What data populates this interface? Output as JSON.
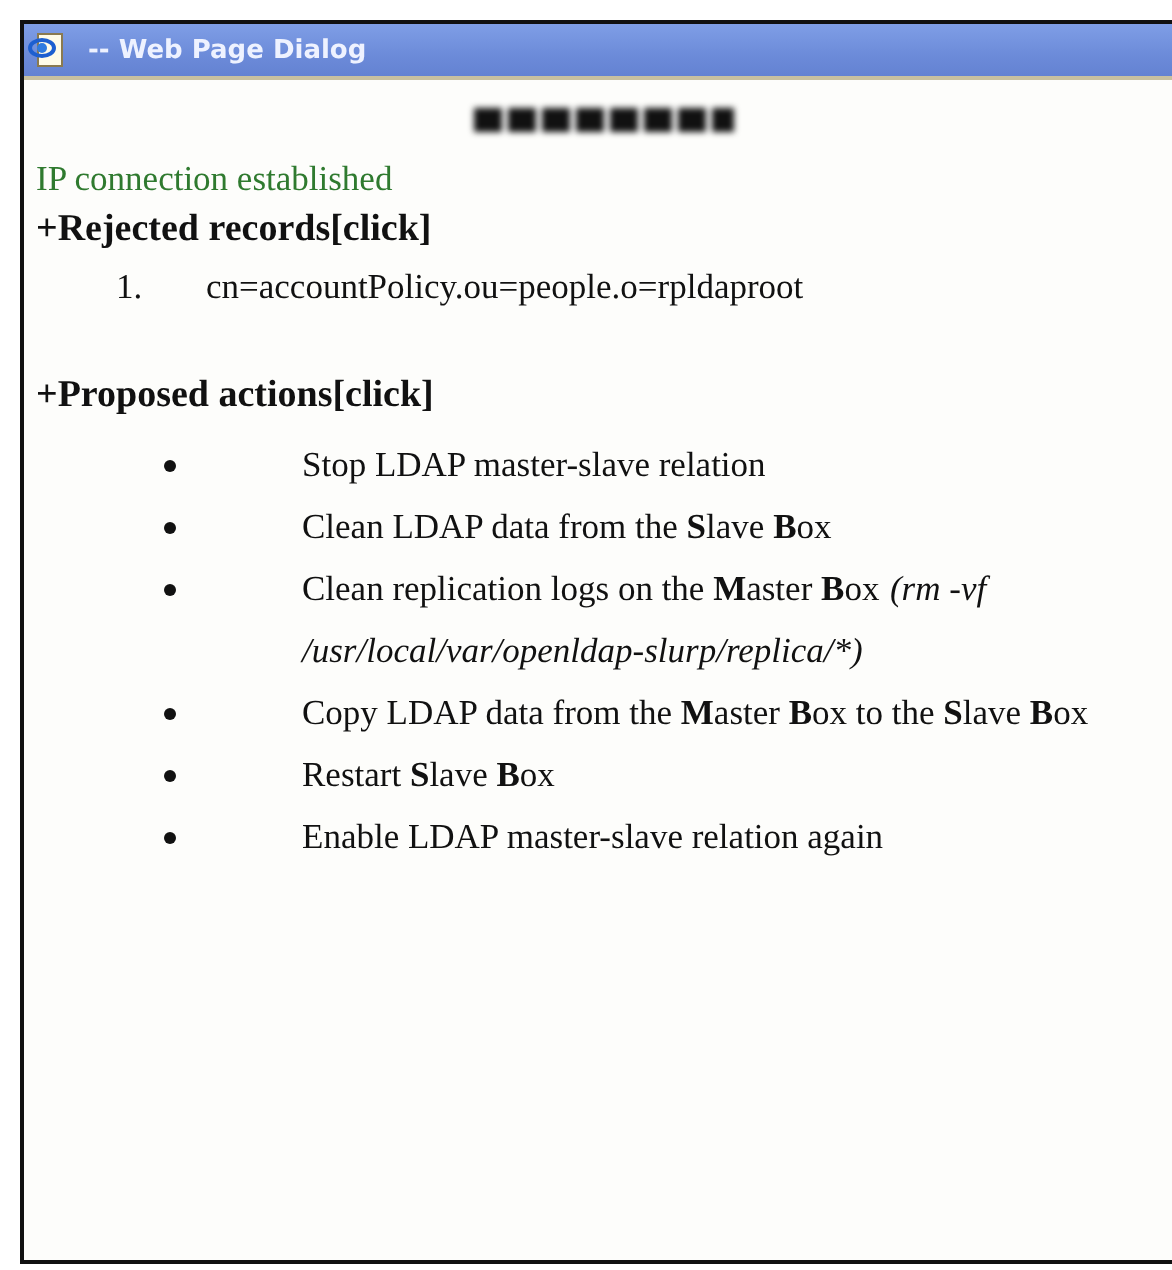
{
  "window": {
    "title": "-- Web Page Dialog"
  },
  "status": "IP connection established",
  "rejected": {
    "heading": "+Rejected records[click]",
    "items": [
      {
        "number": "1.",
        "text": "cn=accountPolicy.ou=people.o=rpldaproot"
      }
    ]
  },
  "proposed": {
    "heading": "+Proposed actions[click]",
    "items": [
      {
        "text": "Stop LDAP master-slave relation"
      },
      {
        "text": "Clean LDAP data from the **S**lave **B**ox"
      },
      {
        "text": "Clean replication logs on the **M**aster **B**ox",
        "note": "(rm -vf /usr/local/var/openldap-slurp/replica/*)"
      },
      {
        "text": "Copy LDAP data from the **M**aster **B**ox to the **S**lave **B**ox"
      },
      {
        "text": "Restart **S**lave **B**ox"
      },
      {
        "text": "Enable LDAP master-slave relation again"
      }
    ]
  }
}
